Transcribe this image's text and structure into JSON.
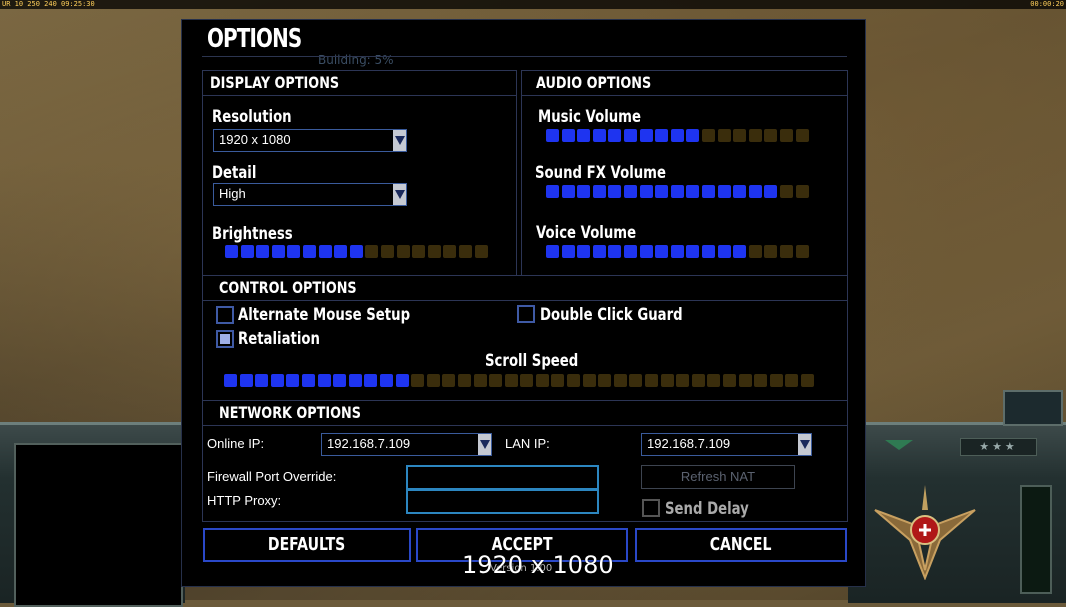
{
  "hud": {
    "top_left": "UR 10 250 240 09:25:30",
    "top_right": "00:00:20",
    "rank_stars": "★★★",
    "building": "Building: 5%"
  },
  "dialog": {
    "title": "OPTIONS",
    "display": {
      "title": "DISPLAY OPTIONS",
      "resolution_label": "Resolution",
      "resolution_value": "1920 x 1080",
      "detail_label": "Detail",
      "detail_value": "High",
      "brightness_label": "Brightness",
      "brightness_level": 9,
      "brightness_total": 17
    },
    "audio": {
      "title": "AUDIO OPTIONS",
      "music_label": "Music Volume",
      "music_level": 10,
      "music_total": 17,
      "sfx_label": "Sound FX Volume",
      "sfx_level": 15,
      "sfx_total": 17,
      "voice_label": "Voice Volume",
      "voice_level": 13,
      "voice_total": 17
    },
    "control": {
      "title": "CONTROL OPTIONS",
      "alt_mouse_label": "Alternate Mouse Setup",
      "alt_mouse_checked": false,
      "double_click_label": "Double Click Guard",
      "double_click_checked": false,
      "retaliation_label": "Retaliation",
      "retaliation_checked": true,
      "scroll_label": "Scroll Speed",
      "scroll_level": 12,
      "scroll_total": 38
    },
    "network": {
      "title": "NETWORK OPTIONS",
      "online_ip_label": "Online IP:",
      "online_ip_value": "192.168.7.109",
      "lan_ip_label": "LAN IP:",
      "lan_ip_value": "192.168.7.109",
      "firewall_label": "Firewall Port Override:",
      "firewall_value": "",
      "proxy_label": "HTTP Proxy:",
      "proxy_value": "",
      "refresh_nat_label": "Refresh NAT",
      "send_delay_label": "Send Delay",
      "send_delay_checked": false
    },
    "buttons": {
      "defaults": "DEFAULTS",
      "accept": "ACCEPT",
      "cancel": "CANCEL"
    },
    "version": "Version 1.00",
    "overlay_resolution": "1920 x 1080"
  },
  "colors": {
    "slider_on": "#1e34f0",
    "slider_off": "#3a2d0c",
    "panel_border": "#2c3555",
    "button_border": "#2a48c8"
  }
}
